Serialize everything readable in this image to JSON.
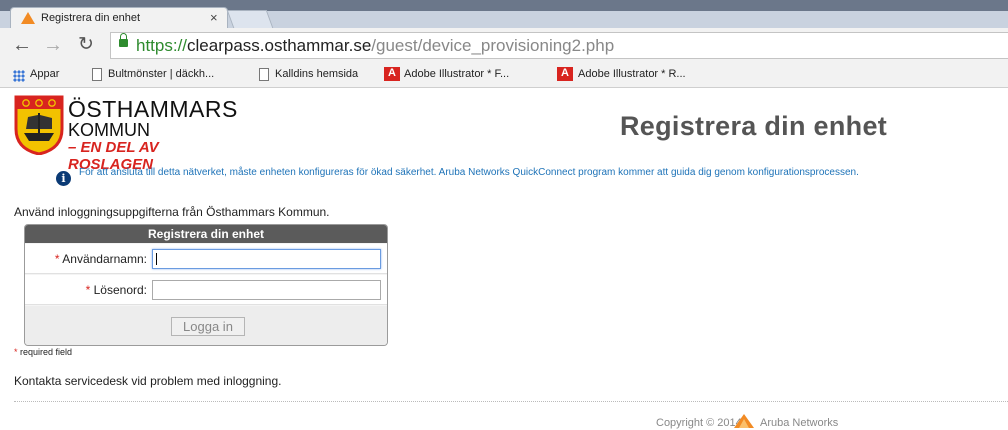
{
  "browser": {
    "tab_title": "Registrera din enhet",
    "tab_close": "×",
    "url_scheme": "https://",
    "url_host": "clearpass.osthammar.se",
    "url_path": "/guest/device_provisioning2.php",
    "bookmarks": [
      "Appar",
      "Bultmönster | däckh...",
      "Kalldins hemsida",
      "Adobe Illustrator * F...",
      "Adobe Illustrator * R..."
    ]
  },
  "logo": {
    "line1": "ÖSTHAMMARS",
    "line2": "KOMMUN",
    "line3": "– EN DEL AV ROSLAGEN"
  },
  "page": {
    "title": "Registrera din enhet",
    "info": "För att ansluta till detta nätverket, måste enheten konfigureras för ökad säkerhet. Aruba Networks QuickConnect program kommer att guida dig genom konfigurationsprocessen.",
    "instruction": "Använd inloggningsuppgifterna från Östhammars Kommun."
  },
  "form": {
    "header": "Registrera din enhet",
    "username_label": "Användarnamn:",
    "password_label": "Lösenord:",
    "required_marker": "*",
    "username_value": "",
    "password_value": "",
    "login_button": "Logga in",
    "required_note": "required field"
  },
  "footer": {
    "contact": "Kontakta servicedesk vid problem med inloggning.",
    "copyright": "Copyright © 2014",
    "brand": "Aruba Networks"
  },
  "colors": {
    "accent_red": "#d8241f",
    "info_blue": "#1e73b8",
    "header_gray": "#5b5b5b",
    "aruba_orange": "#f28b24"
  },
  "icons": [
    "aruba-favicon",
    "back-arrow-icon",
    "forward-arrow-icon",
    "reload-icon",
    "lock-icon",
    "apps-grid-icon",
    "page-icon",
    "adobe-icon",
    "info-icon",
    "municipality-crest"
  ]
}
